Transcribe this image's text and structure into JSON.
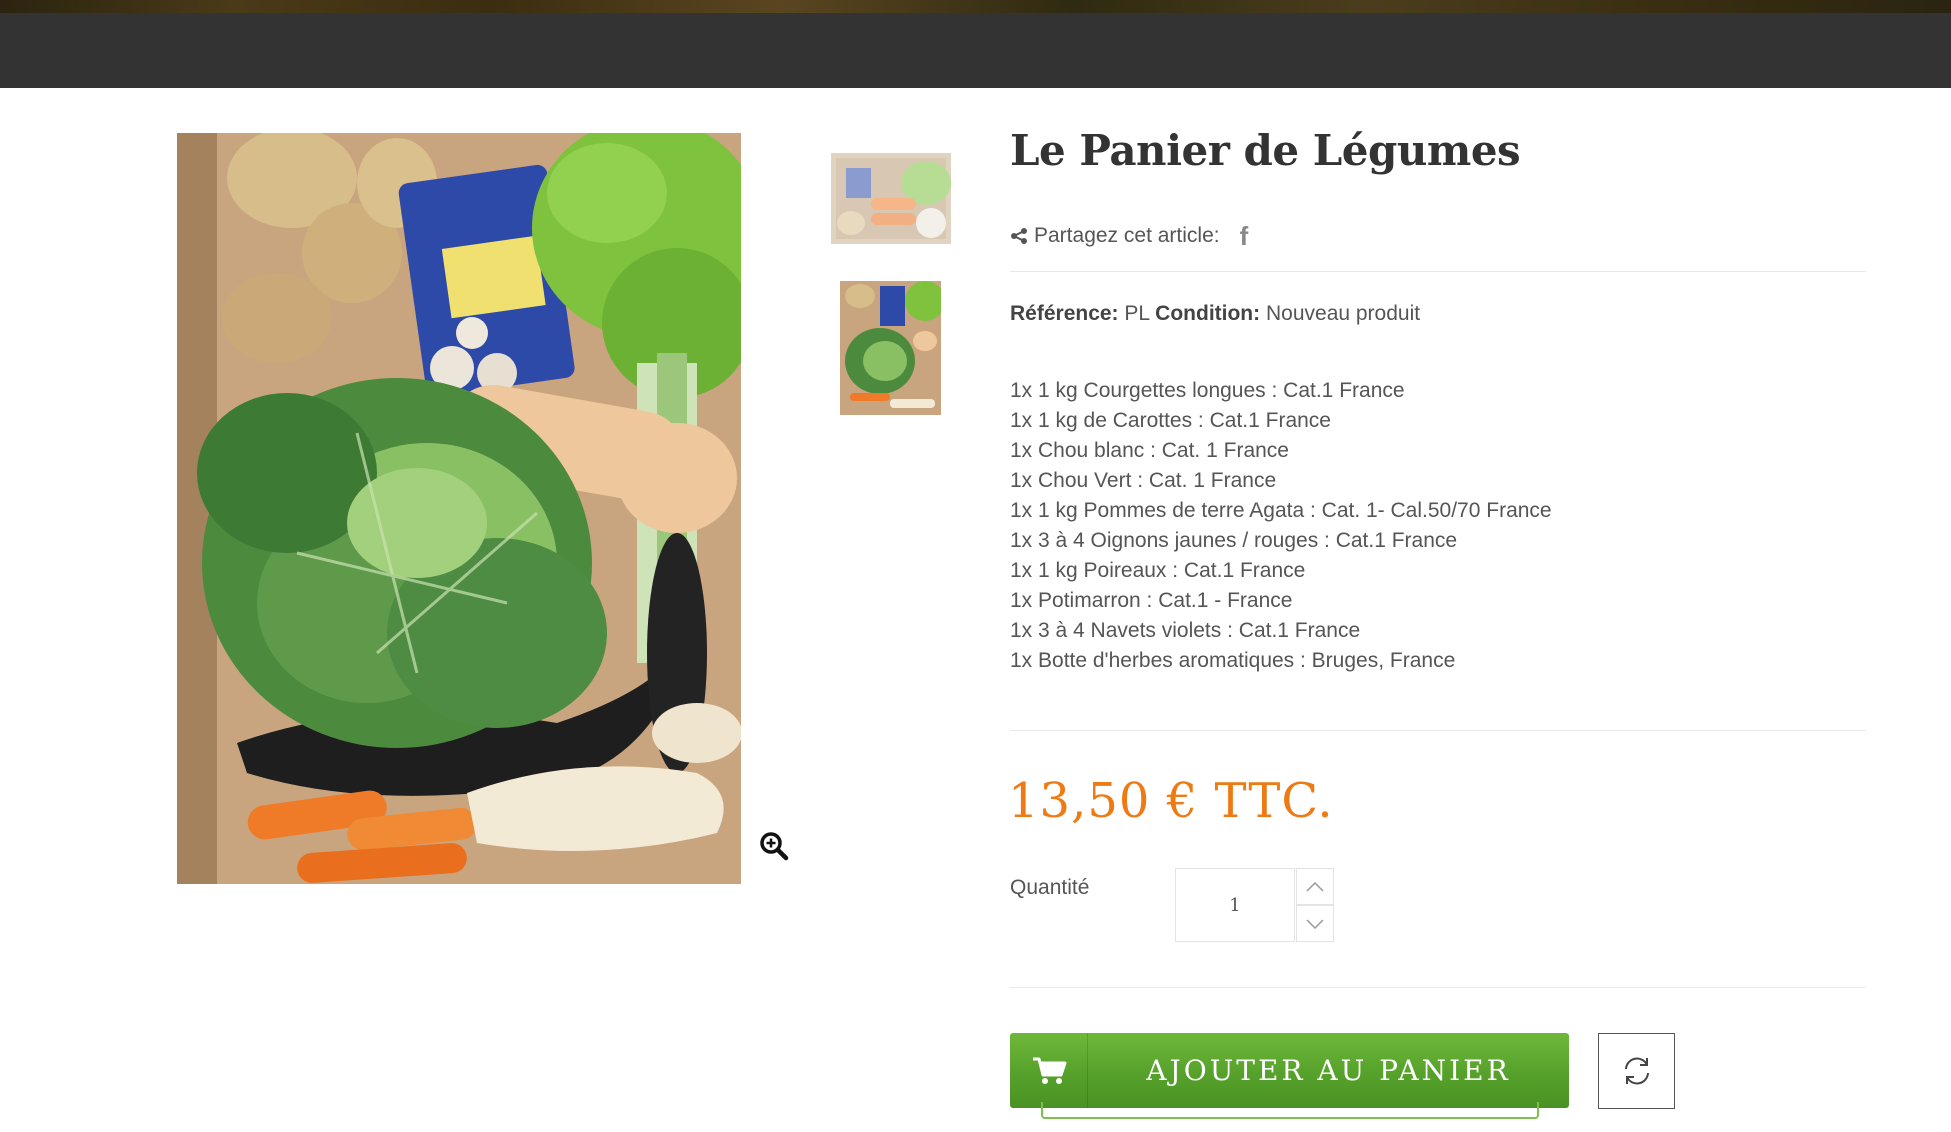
{
  "product": {
    "title": "Le Panier de Légumes",
    "share_label": "Partagez cet article:",
    "reference_label": "Référence:",
    "reference_value": "PL",
    "condition_label": "Condition:",
    "condition_value": "Nouveau produit",
    "description": [
      "1x 1 kg Courgettes longues : Cat.1 France",
      "1x 1 kg de Carottes : Cat.1 France",
      "1x Chou blanc : Cat. 1 France",
      "1x Chou Vert : Cat. 1 France",
      "1x 1 kg Pommes de terre Agata : Cat. 1- Cal.50/70 France",
      "1x 3 à 4 Oignons jaunes / rouges : Cat.1 France",
      "1x 1 kg Poireaux : Cat.1 France",
      "1x Potimarron : Cat.1 - France",
      "1x 3 à 4 Navets violets : Cat.1 France",
      "1x Botte d'herbes aromatiques : Bruges, France"
    ],
    "price": "13,50 € TTC.",
    "quantity_label": "Quantité",
    "quantity_value": "1",
    "add_to_cart_label": "AJOUTER AU PANIER"
  },
  "icons": {
    "share": "share-icon",
    "facebook": "facebook-icon",
    "zoom": "zoom-in-icon",
    "cart": "cart-icon",
    "refresh": "refresh-icon",
    "qty_up": "chevron-up-icon",
    "qty_down": "chevron-down-icon"
  },
  "colors": {
    "nav_bar": "#333333",
    "price": "#ee7a14",
    "cart_button": "#5aa52e",
    "title": "#333333"
  }
}
